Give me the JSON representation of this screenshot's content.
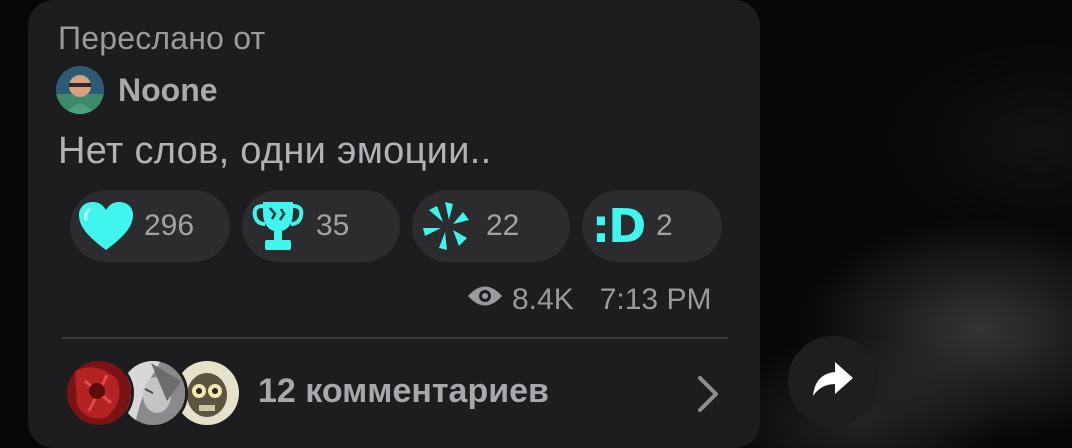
{
  "message": {
    "forwarded_label": "Переслано от",
    "author_name": "Noone",
    "text": "Нет слов, одни эмоции.."
  },
  "reactions": [
    {
      "icon": "heart-icon",
      "count": "296",
      "color": "#3ff5ee"
    },
    {
      "icon": "trophy-icon",
      "count": "35",
      "color": "#3ff5ee"
    },
    {
      "icon": "sparkle-burst-icon",
      "count": "22",
      "color": "#3ff5ee"
    },
    {
      "icon": "laugh-face-text-icon",
      "label": ":D",
      "count": "2",
      "color": "#3ff5ee"
    }
  ],
  "meta": {
    "views": "8.4K",
    "time": "7:13 PM"
  },
  "comments": {
    "label": "12 комментариев",
    "avatars": [
      "red-anime-avatar",
      "grey-anime-avatar",
      "skull-avatar"
    ]
  },
  "colors": {
    "bubble": "#1d1d1f",
    "accent": "#3ff5ee",
    "text": "#b2b2b6"
  }
}
